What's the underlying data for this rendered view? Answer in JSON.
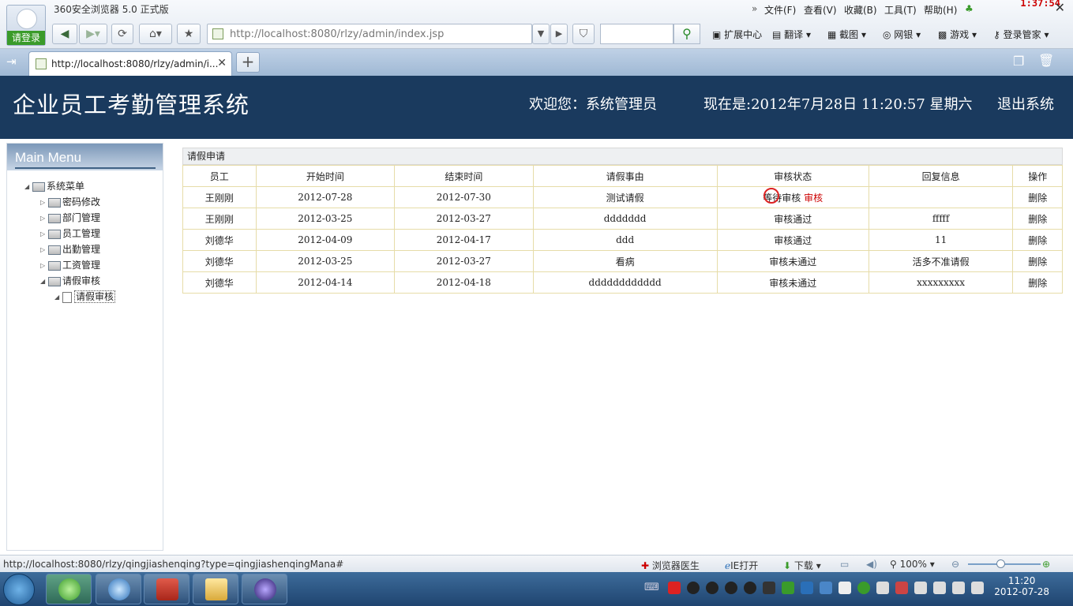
{
  "browser": {
    "title": "360安全浏览器 5.0 正式版",
    "login_label": "请登录",
    "address": "http://localhost:8080/rlzy/admin/index.jsp",
    "menus": [
      "文件(F)",
      "查看(V)",
      "收藏(B)",
      "工具(T)",
      "帮助(H)"
    ],
    "clock": "1:37:54",
    "tools": [
      "扩展中心",
      "翻译",
      "截图",
      "网银",
      "游戏",
      "登录管家"
    ],
    "tab_title": "http://localhost:8080/rlzy/admin/i..."
  },
  "header": {
    "title": "企业员工考勤管理系统",
    "welcome": "欢迎您：系统管理员",
    "now": "现在是:2012年7月28日  11:20:57 星期六",
    "logout": "退出系统"
  },
  "sidebar": {
    "heading": "Main Menu",
    "root": "系统菜单",
    "items": [
      "密码修改",
      "部门管理",
      "员工管理",
      "出勤管理",
      "工资管理",
      "请假审核"
    ],
    "sub_item": "请假审核"
  },
  "panel": {
    "title": "请假申请",
    "columns": [
      "员工",
      "开始时间",
      "结束时间",
      "请假事由",
      "审核状态",
      "回复信息",
      "操作"
    ],
    "rows": [
      {
        "employee": "王刚刚",
        "start": "2012-07-28",
        "end": "2012-07-30",
        "reason": "测试请假",
        "status": "等待审核",
        "action_link": "审核",
        "reply": "",
        "op": "删除"
      },
      {
        "employee": "王刚刚",
        "start": "2012-03-25",
        "end": "2012-03-27",
        "reason": "ddddddd",
        "status": "审核通过",
        "action_link": "",
        "reply": "fffff",
        "op": "删除"
      },
      {
        "employee": "刘德华",
        "start": "2012-04-09",
        "end": "2012-04-17",
        "reason": "ddd",
        "status": "审核通过",
        "action_link": "",
        "reply": "11",
        "op": "删除"
      },
      {
        "employee": "刘德华",
        "start": "2012-03-25",
        "end": "2012-03-27",
        "reason": "看病",
        "status": "审核未通过",
        "action_link": "",
        "reply": "活多不准请假",
        "op": "删除"
      },
      {
        "employee": "刘德华",
        "start": "2012-04-14",
        "end": "2012-04-18",
        "reason": "dddddddddddd",
        "status": "审核未通过",
        "action_link": "",
        "reply": "xxxxxxxxx",
        "op": "删除"
      }
    ]
  },
  "status": {
    "url": "http://localhost:8080/rlzy/qingjiashenqing?type=qingjiashenqingMana#",
    "doctor": "浏览器医生",
    "ie": "IE打开",
    "download": "下载",
    "zoom": "100%"
  },
  "taskbar": {
    "time": "11:20",
    "date": "2012-07-28"
  },
  "colors": {
    "header_bg": "#1a3a5e",
    "link": "#cc0000",
    "table_border": "#e6dca8"
  }
}
